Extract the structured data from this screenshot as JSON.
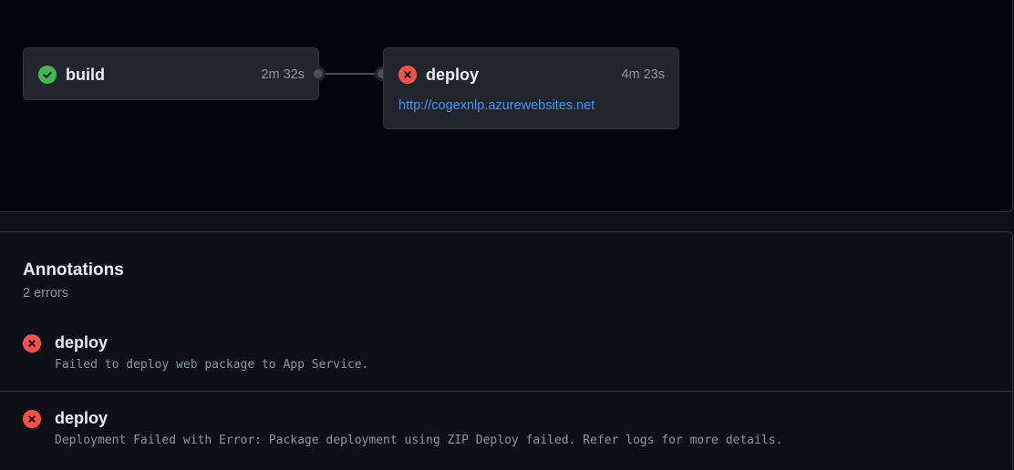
{
  "colors": {
    "success": "#3fb950",
    "error": "#f85149",
    "link": "#4493f8",
    "muted": "#8b949e"
  },
  "graph": {
    "jobs": [
      {
        "name": "build",
        "duration": "2m 32s",
        "status": "success",
        "icon": "check-circle-icon"
      },
      {
        "name": "deploy",
        "duration": "4m 23s",
        "status": "failure",
        "icon": "x-circle-icon",
        "link": "http://cogexnlp.azurewebsites.net"
      }
    ]
  },
  "annotations": {
    "title": "Annotations",
    "count": "2 errors",
    "items": [
      {
        "job": "deploy",
        "message": "Failed to deploy web package to App Service.",
        "icon": "x-circle-icon"
      },
      {
        "job": "deploy",
        "message": "Deployment Failed with Error: Package deployment using ZIP Deploy failed. Refer logs for more details.",
        "icon": "x-circle-icon"
      }
    ]
  }
}
